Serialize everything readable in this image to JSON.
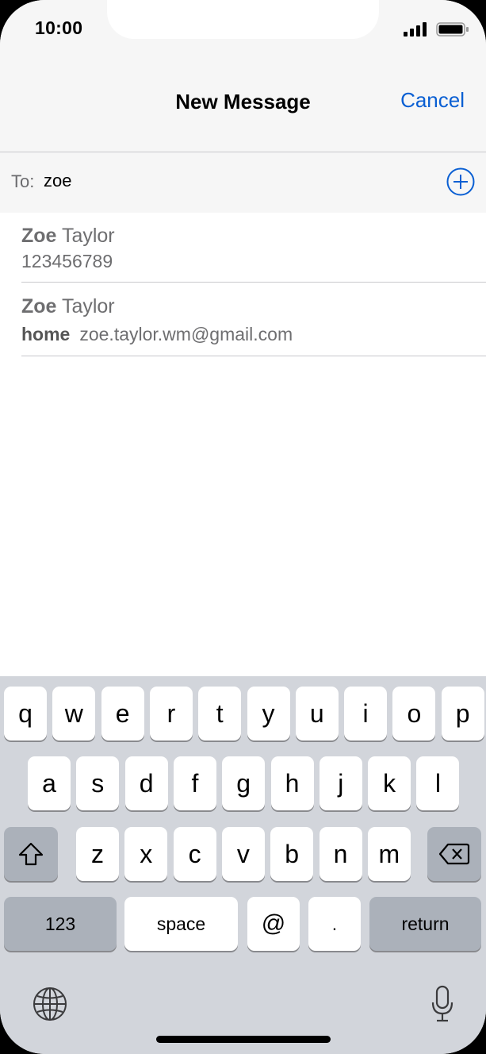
{
  "status_bar": {
    "time": "10:00",
    "icons": [
      "signal-icon",
      "battery-icon"
    ]
  },
  "navbar": {
    "title": "New Message",
    "cancel_label": "Cancel",
    "accent_color": "#0a5fd3"
  },
  "to_row": {
    "label": "To:",
    "value": "zoe",
    "add_icon": "plus-circle-icon"
  },
  "suggestions": [
    {
      "name_match": "Zoe",
      "name_rest": " Taylor",
      "detail_label": "",
      "detail": "123456789"
    },
    {
      "name_match": "Zoe",
      "name_rest": " Taylor",
      "detail_label": "home",
      "detail": "zoe.taylor.wm@gmail.com"
    }
  ],
  "keyboard": {
    "row1": [
      "q",
      "w",
      "e",
      "r",
      "t",
      "y",
      "u",
      "i",
      "o",
      "p"
    ],
    "row2": [
      "a",
      "s",
      "d",
      "f",
      "g",
      "h",
      "j",
      "k",
      "l"
    ],
    "row3": [
      "z",
      "x",
      "c",
      "v",
      "b",
      "n",
      "m"
    ],
    "numbers_label": "123",
    "space_label": "space",
    "at_label": "@",
    "dot_label": ".",
    "return_label": "return",
    "icons": [
      "shift-icon",
      "delete-icon",
      "globe-icon",
      "microphone-icon"
    ]
  }
}
